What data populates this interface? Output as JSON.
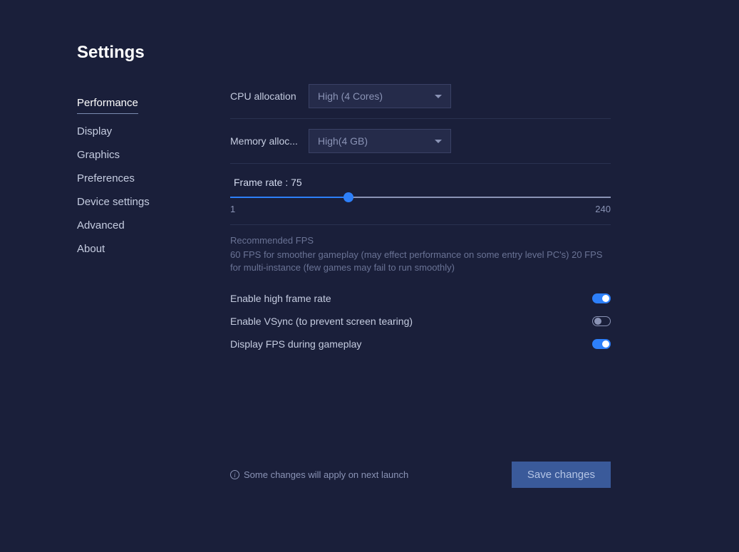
{
  "page_title": "Settings",
  "sidebar": {
    "items": [
      {
        "label": "Performance",
        "active": true
      },
      {
        "label": "Display",
        "active": false
      },
      {
        "label": "Graphics",
        "active": false
      },
      {
        "label": "Preferences",
        "active": false
      },
      {
        "label": "Device settings",
        "active": false
      },
      {
        "label": "Advanced",
        "active": false
      },
      {
        "label": "About",
        "active": false
      }
    ]
  },
  "settings": {
    "cpu": {
      "label": "CPU allocation",
      "value": "High (4 Cores)"
    },
    "memory": {
      "label": "Memory alloc...",
      "value": "High(4 GB)"
    },
    "frame_rate": {
      "label_prefix": "Frame rate : ",
      "value": "75",
      "min": "1",
      "max": "240"
    },
    "fps_recommend": {
      "title": "Recommended FPS",
      "desc": "60 FPS for smoother gameplay (may effect performance on some entry level PC's) 20 FPS for multi-instance (few games may fail to run smoothly)"
    },
    "toggles": {
      "high_frame": {
        "label": "Enable high frame rate",
        "on": true
      },
      "vsync": {
        "label": "Enable VSync (to prevent screen tearing)",
        "on": false
      },
      "display_fps": {
        "label": "Display FPS during gameplay",
        "on": true
      }
    }
  },
  "footer": {
    "note": "Some changes will apply on next launch",
    "save_label": "Save changes"
  }
}
